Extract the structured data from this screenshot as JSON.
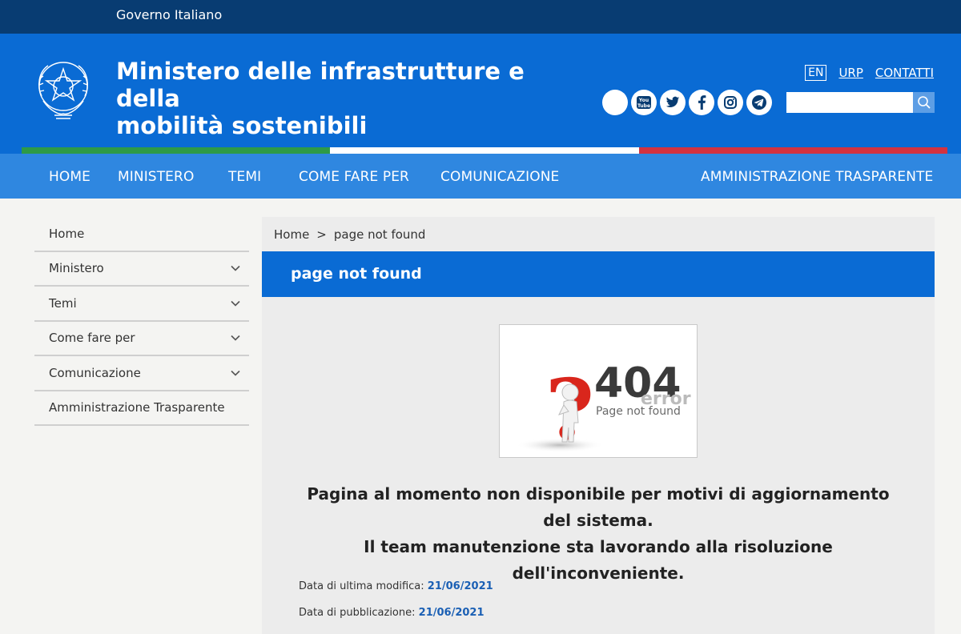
{
  "top_bar": {
    "gov_label": "Governo Italiano"
  },
  "header": {
    "ministry_name_line1": "Ministero delle infrastrutture e della",
    "ministry_name_line2": "mobilità sostenibili",
    "links": {
      "lang": "EN",
      "urp": "URP",
      "contatti": "CONTATTI"
    },
    "social_icons": [
      "generic-circle-icon",
      "youtube-icon",
      "twitter-icon",
      "facebook-icon",
      "instagram-icon",
      "telegram-icon"
    ],
    "youtube_text": "You Tube",
    "search": {
      "placeholder": "",
      "value": ""
    }
  },
  "tricolor": [
    "#2e9a47",
    "#ffffff",
    "#d33240"
  ],
  "nav": {
    "items": [
      "HOME",
      "MINISTERO",
      "TEMI",
      "COME FARE PER",
      "COMUNICAZIONE",
      "AMMINISTRAZIONE TRASPARENTE"
    ]
  },
  "sidebar": {
    "items": [
      {
        "label": "Home",
        "expandable": false
      },
      {
        "label": "Ministero",
        "expandable": true
      },
      {
        "label": "Temi",
        "expandable": true
      },
      {
        "label": "Come fare per",
        "expandable": true
      },
      {
        "label": "Comunicazione",
        "expandable": true
      },
      {
        "label": "Amministrazione Trasparente",
        "expandable": false
      }
    ]
  },
  "breadcrumb": {
    "home": "Home",
    "separator": ">",
    "current": "page not found"
  },
  "page": {
    "title": "page not found",
    "error_image": {
      "code": "404",
      "sub": "error",
      "caption": "Page not found",
      "glyph": "?"
    },
    "message_line1": "Pagina al momento non disponibile per motivi di aggiornamento del sistema.",
    "message_line2": "Il team manutenzione sta lavorando alla risoluzione dell'inconveniente.",
    "last_modified_label": "Data di ultima modifica:",
    "last_modified_value": "21/06/2021",
    "published_label": "Data di pubblicazione:",
    "published_value": "21/06/2021"
  },
  "colors": {
    "top_bar": "#083c72",
    "header": "#0a6bd4",
    "nav": "#2f87e0",
    "link_value": "#1a5fb4"
  }
}
